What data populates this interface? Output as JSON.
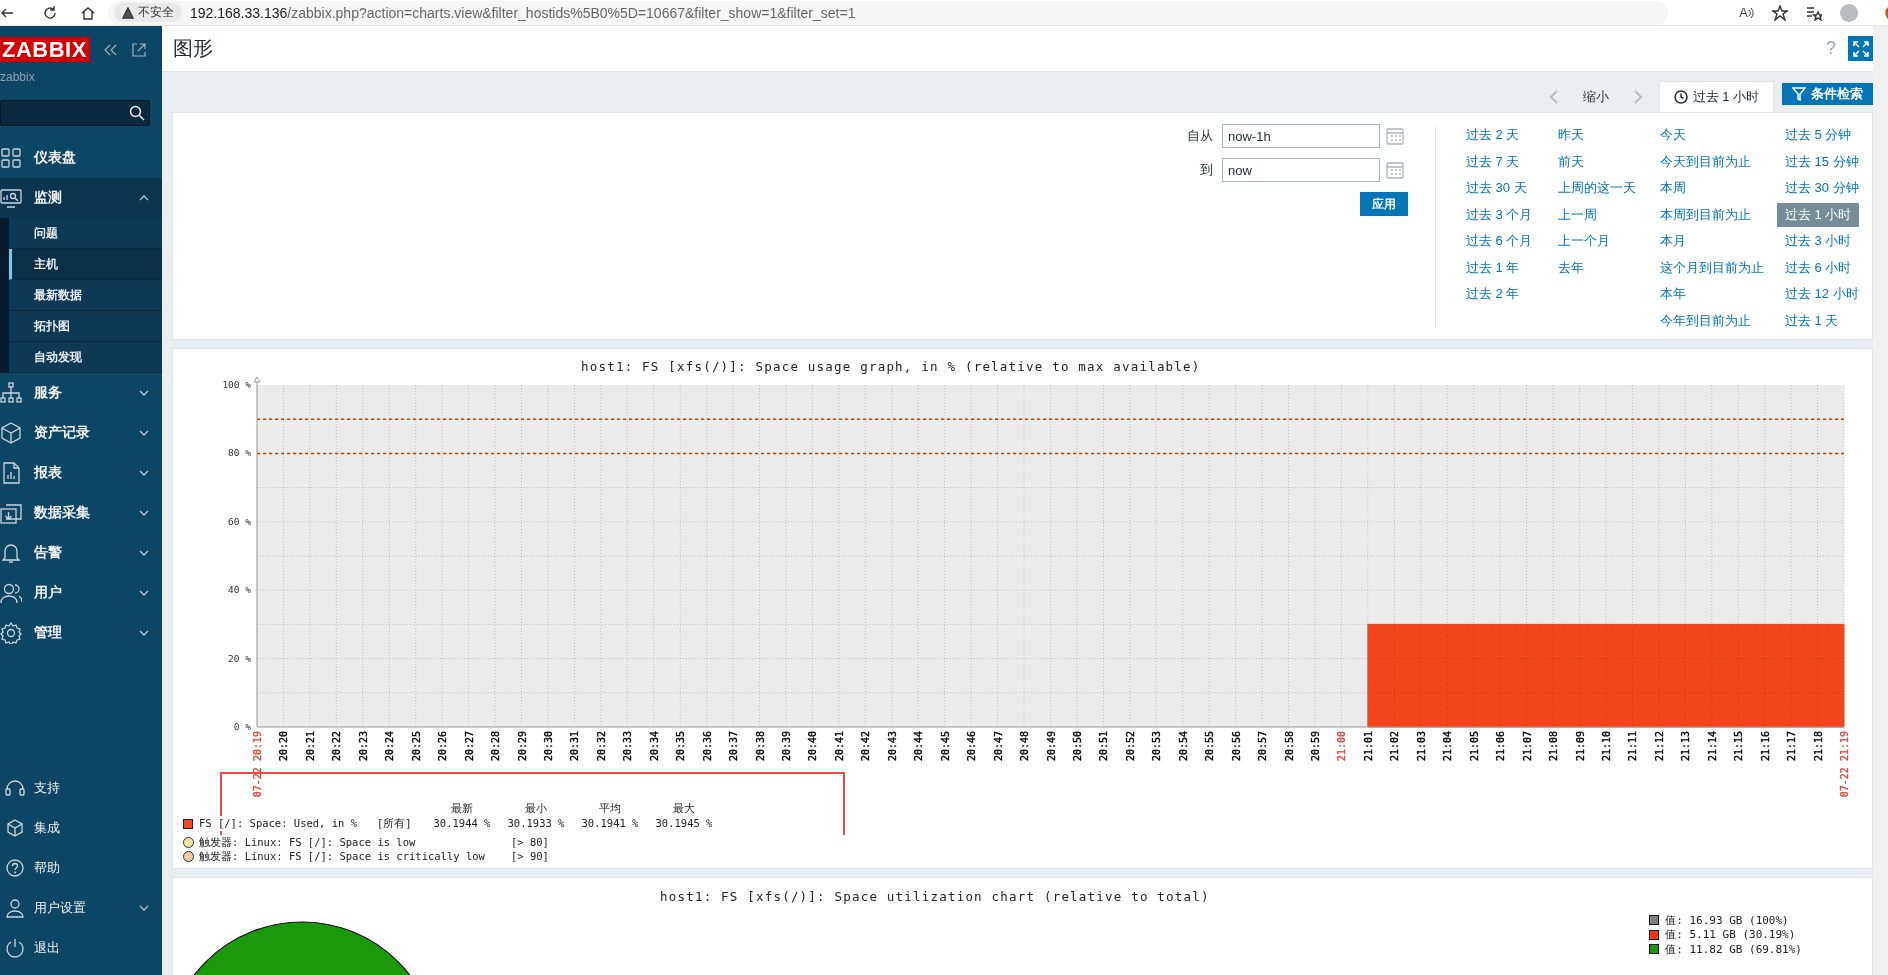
{
  "browser": {
    "read_aloud": "A",
    "security": "不安全",
    "host": "192.168.33.136",
    "path": "/zabbix.php?action=charts.view&filter_hostids%5B0%5D=10667&filter_show=1&filter_set=1"
  },
  "sidebar": {
    "logo": "ZABBIX",
    "server": "zabbix",
    "menu": [
      {
        "label": "仪表盘",
        "kind": "link"
      },
      {
        "label": "监测",
        "kind": "group",
        "expanded": true,
        "children": [
          {
            "label": "问题",
            "selected": false
          },
          {
            "label": "主机",
            "selected": true
          },
          {
            "label": "最新数据",
            "selected": false
          },
          {
            "label": "拓扑图",
            "selected": false
          },
          {
            "label": "自动发现",
            "selected": false
          }
        ]
      },
      {
        "label": "服务",
        "kind": "group",
        "expanded": false
      },
      {
        "label": "资产记录",
        "kind": "group",
        "expanded": false
      },
      {
        "label": "报表",
        "kind": "group",
        "expanded": false
      },
      {
        "label": "数据采集",
        "kind": "group",
        "expanded": false
      },
      {
        "label": "告警",
        "kind": "group",
        "expanded": false
      },
      {
        "label": "用户",
        "kind": "group",
        "expanded": false
      },
      {
        "label": "管理",
        "kind": "group",
        "expanded": false
      }
    ],
    "bottom_menu": [
      {
        "label": "支持",
        "kind": "link"
      },
      {
        "label": "集成",
        "kind": "link"
      },
      {
        "label": "帮助",
        "kind": "link"
      },
      {
        "label": "用户设置",
        "kind": "group",
        "expanded": false
      },
      {
        "label": "退出",
        "kind": "link"
      }
    ]
  },
  "header": {
    "title": "图形",
    "help": "?"
  },
  "timeline": {
    "zoom_out": "缩小",
    "time_tab": {
      "label": "过去 1 小时",
      "selected": true
    },
    "filter_button": "条件检索"
  },
  "filter": {
    "from": {
      "label": "自从",
      "value": "now-1h"
    },
    "to": {
      "label": "到",
      "value": "now"
    },
    "apply": "应用",
    "range_columns": [
      [
        {
          "label": "过去 2 天",
          "selected": false
        },
        {
          "label": "过去 7 天",
          "selected": false
        },
        {
          "label": "过去 30 天",
          "selected": false
        },
        {
          "label": "过去 3 个月",
          "selected": false
        },
        {
          "label": "过去 6 个月",
          "selected": false
        },
        {
          "label": "过去 1 年",
          "selected": false
        },
        {
          "label": "过去 2 年",
          "selected": false
        }
      ],
      [
        {
          "label": "昨天",
          "selected": false
        },
        {
          "label": "前天",
          "selected": false
        },
        {
          "label": "上周的这一天",
          "selected": false
        },
        {
          "label": "上一周",
          "selected": false
        },
        {
          "label": "上一个月",
          "selected": false
        },
        {
          "label": "去年",
          "selected": false
        }
      ],
      [
        {
          "label": "今天",
          "selected": false
        },
        {
          "label": "今天到目前为止",
          "selected": false
        },
        {
          "label": "本周",
          "selected": false
        },
        {
          "label": "本周到目前为止",
          "selected": false
        },
        {
          "label": "本月",
          "selected": false
        },
        {
          "label": "这个月到目前为止",
          "selected": false
        },
        {
          "label": "本年",
          "selected": false
        },
        {
          "label": "今年到目前为止",
          "selected": false
        }
      ],
      [
        {
          "label": "过去 5 分钟",
          "selected": false
        },
        {
          "label": "过去 15 分钟",
          "selected": false
        },
        {
          "label": "过去 30 分钟",
          "selected": false
        },
        {
          "label": "过去 1 小时",
          "selected": true
        },
        {
          "label": "过去 3 小时",
          "selected": false
        },
        {
          "label": "过去 6 小时",
          "selected": false
        },
        {
          "label": "过去 12 小时",
          "selected": false
        },
        {
          "label": "过去 1 天",
          "selected": false
        }
      ]
    ]
  },
  "graph": {
    "chart_data": {
      "type": "area",
      "title": "host1: FS [xfs(/)]: Space usage graph, in % (relative to max available)",
      "ylim": [
        0,
        100
      ],
      "grid": true,
      "yticks": [
        {
          "value": 0,
          "label": "0 %"
        },
        {
          "value": 20,
          "label": "20 %"
        },
        {
          "value": 40,
          "label": "40 %"
        },
        {
          "value": 60,
          "label": "60 %"
        },
        {
          "value": 80,
          "label": "80 %"
        },
        {
          "value": 100,
          "label": "100 %"
        }
      ],
      "categories": [
        "07-22 20:19",
        "20:20",
        "20:21",
        "20:22",
        "20:23",
        "20:24",
        "20:25",
        "20:26",
        "20:27",
        "20:28",
        "20:29",
        "20:30",
        "20:31",
        "20:32",
        "20:33",
        "20:34",
        "20:35",
        "20:36",
        "20:37",
        "20:38",
        "20:39",
        "20:40",
        "20:41",
        "20:42",
        "20:43",
        "20:44",
        "20:45",
        "20:46",
        "20:47",
        "20:48",
        "20:49",
        "20:50",
        "20:51",
        "20:52",
        "20:53",
        "20:54",
        "20:55",
        "20:56",
        "20:57",
        "20:58",
        "20:59",
        "21:00",
        "21:01",
        "21:02",
        "21:03",
        "21:04",
        "21:05",
        "21:06",
        "21:07",
        "21:08",
        "21:09",
        "21:10",
        "21:11",
        "21:12",
        "21:13",
        "21:14",
        "21:15",
        "21:16",
        "21:17",
        "21:18",
        "07-22 21:19"
      ],
      "series": [
        {
          "name": "FS [/]: Space: Used, in %",
          "color": "#f4461c",
          "values": [
            null,
            null,
            null,
            null,
            null,
            null,
            null,
            null,
            null,
            null,
            null,
            null,
            null,
            null,
            null,
            null,
            null,
            null,
            null,
            null,
            null,
            null,
            null,
            null,
            null,
            null,
            null,
            null,
            null,
            null,
            null,
            null,
            null,
            null,
            null,
            null,
            null,
            null,
            null,
            null,
            null,
            null,
            30,
            30,
            30,
            30,
            30,
            30,
            30,
            30,
            30,
            30,
            30,
            30,
            30,
            30,
            30,
            30,
            30,
            30,
            30
          ]
        }
      ],
      "ref_lines": [
        {
          "axis": "y",
          "value": 90,
          "color": "#b34a00"
        },
        {
          "axis": "y",
          "value": 80,
          "color": "#b34a00"
        }
      ]
    },
    "x_labels": [
      {
        "color": "#e8413a"
      },
      {
        "color": "#000000"
      },
      {
        "color": "#000000"
      },
      {
        "color": "#000000"
      },
      {
        "color": "#000000"
      },
      {
        "color": "#000000"
      },
      {
        "color": "#000000"
      },
      {
        "color": "#000000"
      },
      {
        "color": "#000000"
      },
      {
        "color": "#000000"
      },
      {
        "color": "#000000"
      },
      {
        "color": "#000000"
      },
      {
        "color": "#000000"
      },
      {
        "color": "#000000"
      },
      {
        "color": "#000000"
      },
      {
        "color": "#000000"
      },
      {
        "color": "#000000"
      },
      {
        "color": "#000000"
      },
      {
        "color": "#000000"
      },
      {
        "color": "#000000"
      },
      {
        "color": "#000000"
      },
      {
        "color": "#000000"
      },
      {
        "color": "#000000"
      },
      {
        "color": "#000000"
      },
      {
        "color": "#000000"
      },
      {
        "color": "#000000"
      },
      {
        "color": "#000000"
      },
      {
        "color": "#000000"
      },
      {
        "color": "#000000"
      },
      {
        "color": "#000000"
      },
      {
        "color": "#000000"
      },
      {
        "color": "#000000"
      },
      {
        "color": "#000000"
      },
      {
        "color": "#000000"
      },
      {
        "color": "#000000"
      },
      {
        "color": "#000000"
      },
      {
        "color": "#000000"
      },
      {
        "color": "#000000"
      },
      {
        "color": "#000000"
      },
      {
        "color": "#000000"
      },
      {
        "color": "#000000"
      },
      {
        "color": "#e8413a"
      },
      {
        "color": "#000000"
      },
      {
        "color": "#000000"
      },
      {
        "color": "#000000"
      },
      {
        "color": "#000000"
      },
      {
        "color": "#000000"
      },
      {
        "color": "#000000"
      },
      {
        "color": "#000000"
      },
      {
        "color": "#000000"
      },
      {
        "color": "#000000"
      },
      {
        "color": "#000000"
      },
      {
        "color": "#000000"
      },
      {
        "color": "#000000"
      },
      {
        "color": "#000000"
      },
      {
        "color": "#000000"
      },
      {
        "color": "#000000"
      },
      {
        "color": "#000000"
      },
      {
        "color": "#000000"
      },
      {
        "color": "#000000"
      },
      {
        "color": "#e8413a"
      }
    ],
    "legend": {
      "headers": [
        "最新",
        "最小",
        "平均",
        "最大"
      ],
      "stats": [
        {
          "scope": "[所有]",
          "values": [
            "30.1944 %",
            "30.1933 %",
            "30.1941 %",
            "30.1945 %"
          ]
        }
      ],
      "triggers": [
        {
          "name": "触发器: Linux: FS [/]: Space is low",
          "condition": "[> 80]",
          "color": "#fce3a6"
        },
        {
          "name": "触发器: Linux: FS [/]: Space is critically low",
          "condition": "[> 90]",
          "color": "#f9c9a3"
        }
      ]
    }
  },
  "pie": {
    "title": "host1: FS [xfs(/)]: Space utilization chart (relative to total)",
    "legend": [
      {
        "label": "值: 16.93 GB (100%)",
        "color": "#808080"
      },
      {
        "label": "值: 5.11 GB (30.19%)",
        "color": "#ff3300"
      },
      {
        "label": "值: 11.82 GB (69.81%)",
        "color": "#1a9a0a"
      }
    ]
  }
}
